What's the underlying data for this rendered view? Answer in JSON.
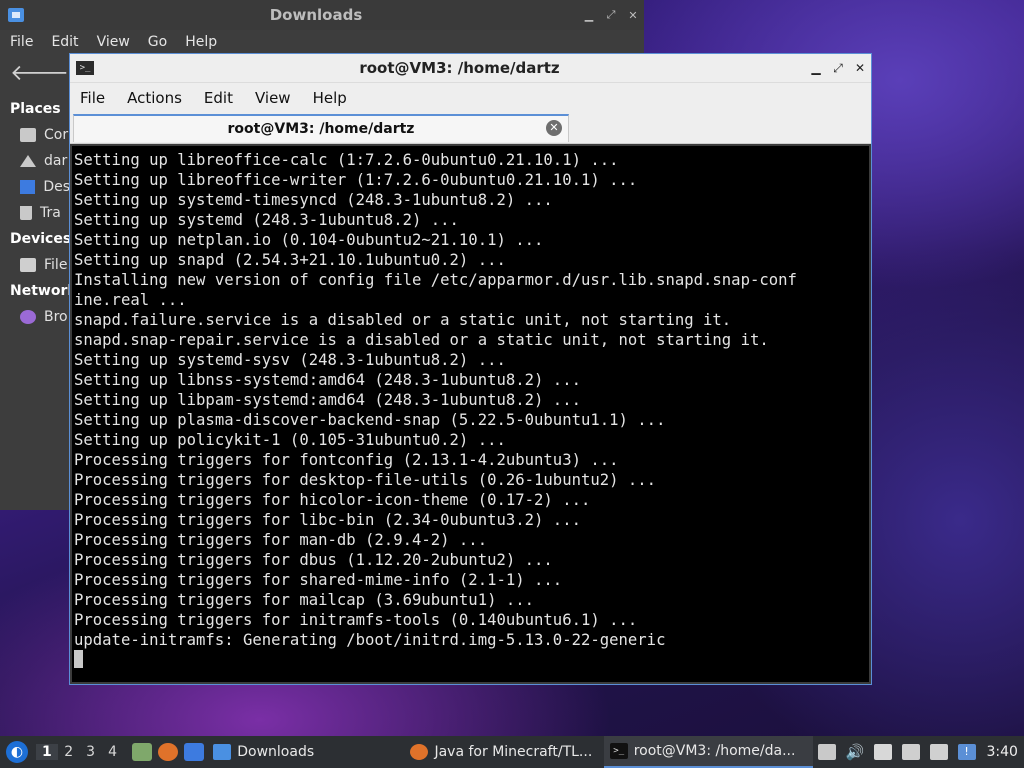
{
  "file_manager": {
    "title": "Downloads",
    "menu": [
      "File",
      "Edit",
      "View",
      "Go",
      "Help"
    ],
    "toolbar": {
      "back_icon": "arrow-left-icon",
      "forward_icon": "arrow-right-icon"
    },
    "sidebar": {
      "places_header": "Places",
      "places": [
        {
          "label": "Cor",
          "icon": "drive-icon"
        },
        {
          "label": "dar",
          "icon": "home-icon"
        },
        {
          "label": "Des",
          "icon": "desktop-icon"
        },
        {
          "label": "Tra",
          "icon": "trash-icon"
        }
      ],
      "devices_header": "Devices",
      "devices": [
        {
          "label": "File",
          "icon": "drive-icon"
        }
      ],
      "network_header": "Network",
      "network": [
        {
          "label": "Bro",
          "icon": "browse-network-icon"
        }
      ]
    }
  },
  "terminal": {
    "title": "root@VM3: /home/dartz",
    "menu": [
      "File",
      "Actions",
      "Edit",
      "View",
      "Help"
    ],
    "tab_label": "root@VM3: /home/dartz",
    "lines": [
      "Setting up libreoffice-calc (1:7.2.6-0ubuntu0.21.10.1) ...",
      "Setting up libreoffice-writer (1:7.2.6-0ubuntu0.21.10.1) ...",
      "Setting up systemd-timesyncd (248.3-1ubuntu8.2) ...",
      "Setting up systemd (248.3-1ubuntu8.2) ...",
      "Setting up netplan.io (0.104-0ubuntu2~21.10.1) ...",
      "Setting up snapd (2.54.3+21.10.1ubuntu0.2) ...",
      "Installing new version of config file /etc/apparmor.d/usr.lib.snapd.snap-conf",
      "ine.real ...",
      "snapd.failure.service is a disabled or a static unit, not starting it.",
      "snapd.snap-repair.service is a disabled or a static unit, not starting it.",
      "Setting up systemd-sysv (248.3-1ubuntu8.2) ...",
      "Setting up libnss-systemd:amd64 (248.3-1ubuntu8.2) ...",
      "Setting up libpam-systemd:amd64 (248.3-1ubuntu8.2) ...",
      "Setting up plasma-discover-backend-snap (5.22.5-0ubuntu1.1) ...",
      "Setting up policykit-1 (0.105-31ubuntu0.2) ...",
      "Processing triggers for fontconfig (2.13.1-4.2ubuntu3) ...",
      "Processing triggers for desktop-file-utils (0.26-1ubuntu2) ...",
      "Processing triggers for hicolor-icon-theme (0.17-2) ...",
      "Processing triggers for libc-bin (2.34-0ubuntu3.2) ...",
      "Processing triggers for man-db (2.9.4-2) ...",
      "Processing triggers for dbus (1.12.20-2ubuntu2) ...",
      "Processing triggers for shared-mime-info (2.1-1) ...",
      "Processing triggers for mailcap (3.69ubuntu1) ...",
      "Processing triggers for initramfs-tools (0.140ubuntu6.1) ...",
      "update-initramfs: Generating /boot/initrd.img-5.13.0-22-generic"
    ]
  },
  "taskbar": {
    "workspaces": [
      "1",
      "2",
      "3",
      "4"
    ],
    "active_workspace": "1",
    "tasks": [
      {
        "label": "Downloads",
        "icon": "folder-icon"
      },
      {
        "label": "Java for Minecraft/TL...",
        "icon": "firefox-icon"
      },
      {
        "label": "root@VM3: /home/da...",
        "icon": "terminal-icon"
      }
    ],
    "clock": "3:40"
  },
  "colors": {
    "accent": "#5b8fd6",
    "terminal_bg": "#000000",
    "terminal_fg": "#e4e4e4",
    "taskbar_bg": "#2c2f33"
  }
}
